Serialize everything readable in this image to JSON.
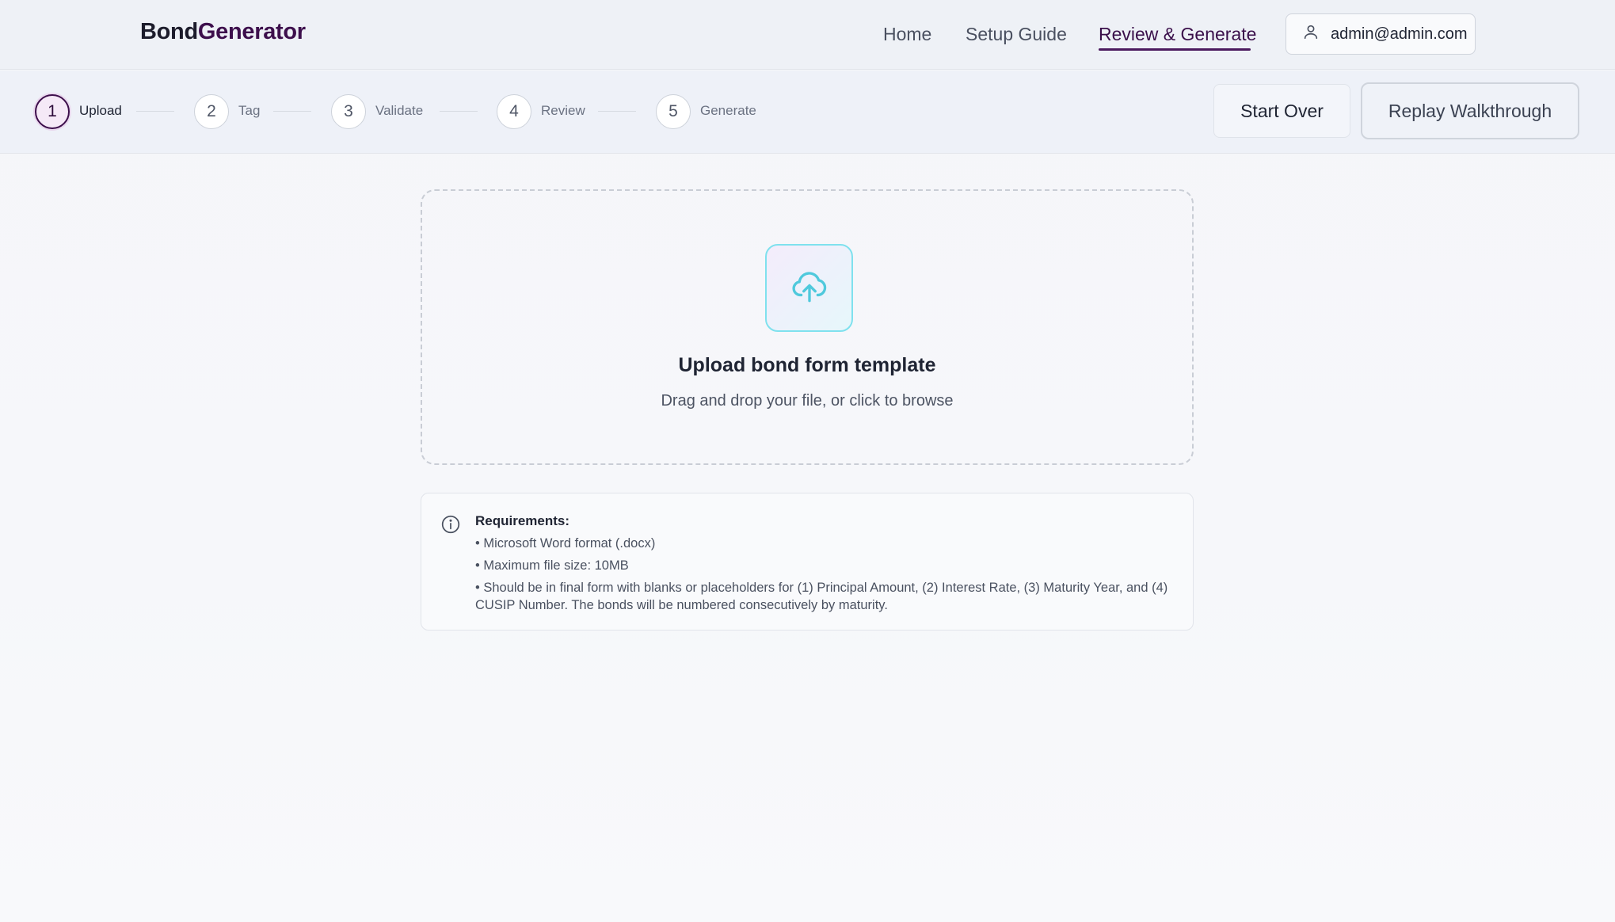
{
  "brand": {
    "part1": "Bond",
    "part2": "Generator"
  },
  "nav": {
    "links": [
      {
        "label": "Home"
      },
      {
        "label": "Setup Guide"
      },
      {
        "label": "Review & Generate"
      }
    ],
    "active": "Review & Generate",
    "user_email": "admin@admin.com"
  },
  "stepper": {
    "steps": [
      {
        "number": "1",
        "label": "Upload",
        "active": true
      },
      {
        "number": "2",
        "label": "Tag",
        "active": false
      },
      {
        "number": "3",
        "label": "Validate",
        "active": false
      },
      {
        "number": "4",
        "label": "Review",
        "active": false
      },
      {
        "number": "5",
        "label": "Generate",
        "active": false
      }
    ],
    "start_over_label": "Start Over",
    "replay_label": "Replay Walkthrough"
  },
  "dropzone": {
    "icon": "cloud-upload-icon",
    "title": "Upload bond form template",
    "subtitle": "Drag and drop your file, or click to browse"
  },
  "requirements": {
    "icon": "info-icon",
    "title": "Requirements:",
    "items": [
      "• Microsoft Word format (.docx)",
      "• Maximum file size: 10MB",
      "• Should be in final form with blanks or placeholders for (1) Principal Amount, (2) Interest Rate, (3) Maturity Year, and (4) CUSIP Number. The bonds will be numbered consecutively by maturity."
    ]
  },
  "colors": {
    "brand_purple": "#3d0f4c",
    "accent_cyan": "#7fe1ee",
    "nav_bg": "#eef1f6"
  }
}
